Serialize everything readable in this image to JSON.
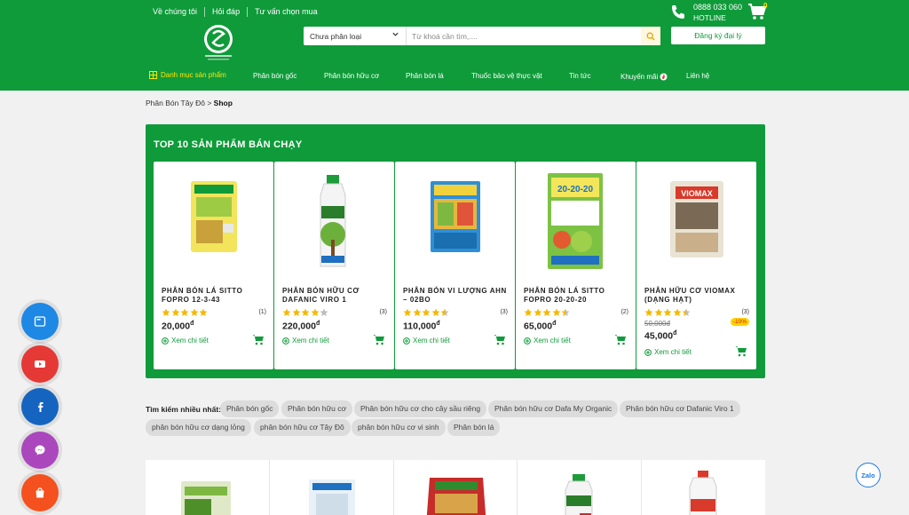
{
  "header": {
    "top_links": [
      "Về chúng tôi",
      "Hỏi đáp",
      "Tư vấn chọn mua"
    ],
    "hotline_number": "0888 033 060",
    "hotline_label": "HOTLINE",
    "cart_count": "0",
    "search_category": "Chưa phân loại",
    "search_placeholder": "Từ khoá cần tìm,....",
    "register_button": "Đăng ký đại lý",
    "nav": {
      "category_menu": "Danh mục sản phẩm",
      "items": [
        "Phân bón gốc",
        "Phân bón hữu cơ",
        "Phân bón lá",
        "Thuốc bảo vệ thực vật",
        "Tin tức",
        "Khuyến mãi",
        "Liên hệ"
      ]
    }
  },
  "breadcrumb": {
    "home": "Phân Bón Tây Đô",
    "separator": ">",
    "current": "Shop"
  },
  "top_products": {
    "title": "TOP 10 SẢN PHẨM BÁN CHẠY",
    "products": [
      {
        "name": "PHÂN BÓN LÁ SITTO FOPRO 12-3-43",
        "rating": 5,
        "reviews": "(1)",
        "price": "20,000",
        "currency": "đ",
        "more": "Xem chi tiết"
      },
      {
        "name": "PHÂN BÓN HỮU CƠ DAFANIC VIRO 1",
        "rating": 4,
        "reviews": "(3)",
        "price": "220,000",
        "currency": "đ",
        "more": "Xem chi tiết"
      },
      {
        "name": "PHÂN BÓN VI LƯỢNG AHN – 02BO",
        "rating": 4.5,
        "reviews": "(3)",
        "price": "110,000",
        "currency": "đ",
        "more": "Xem chi tiết"
      },
      {
        "name": "PHÂN BÓN LÁ SITTO FOPRO 20-20-20",
        "rating": 4.5,
        "reviews": "(2)",
        "price": "65,000",
        "currency": "đ",
        "more": "Xem chi tiết"
      },
      {
        "name": "PHÂN HỮU CƠ VIOMAX (DẠNG HẠT)",
        "rating": 4.5,
        "reviews": "(3)",
        "old_price": "50,000đ",
        "discount": "-10%",
        "price": "45,000",
        "currency": "đ",
        "more": "Xem chi tiết"
      }
    ]
  },
  "popular_search": {
    "label": "Tìm kiếm nhiều nhất:",
    "tags": [
      "Phân bón gốc",
      "Phân bón hữu cơ",
      "Phân bón hữu cơ cho cây sầu riêng",
      "Phân bón hữu cơ Dafa My Organic",
      "Phân bón hữu cơ Dafanic Viro 1",
      "phân bón hữu cơ dạng lỏng",
      "phân bón hữu cơ Tây Đô",
      "phân bón hữu cơ vi sinh",
      "Phân bón lá"
    ]
  },
  "floating_social": [
    {
      "icon": "message-icon",
      "color": "#1e88e5"
    },
    {
      "icon": "youtube-icon",
      "color": "#e53935"
    },
    {
      "icon": "facebook-icon",
      "color": "#1565c0"
    },
    {
      "icon": "messenger-icon",
      "color": "#ab47bc"
    },
    {
      "icon": "shopee-icon",
      "color": "#f4511e"
    }
  ],
  "zalo_label": "Zalo",
  "colors": {
    "brand_green": "#0f9b3a",
    "star": "#f5b800",
    "accent_yellow": "#ffe600"
  }
}
